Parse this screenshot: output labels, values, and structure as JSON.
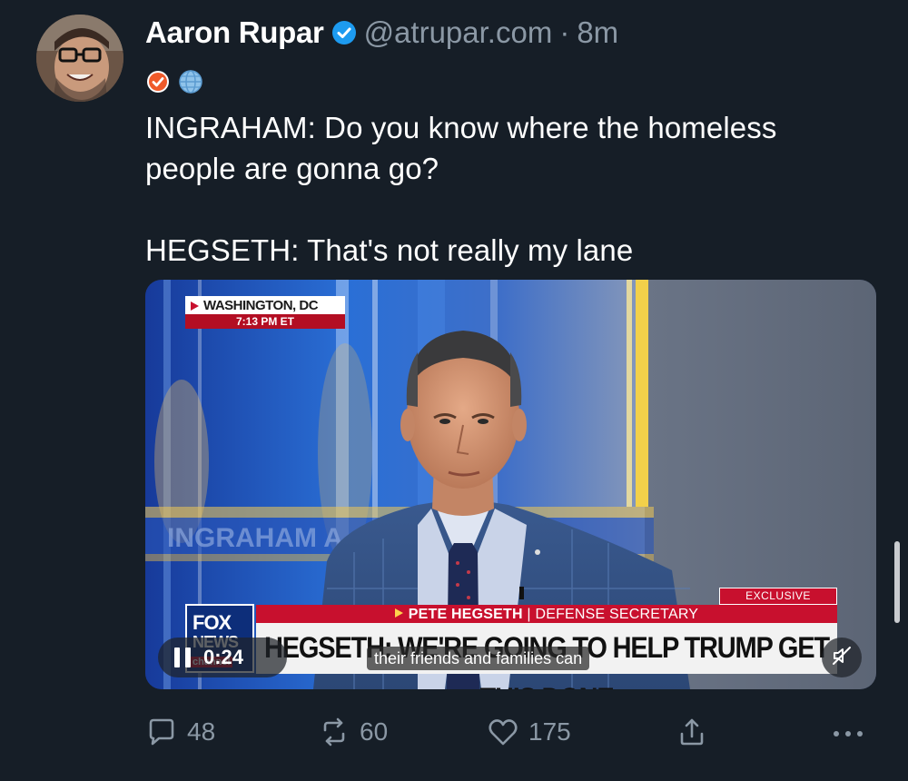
{
  "author": {
    "display_name": "Aaron Rupar",
    "handle": "@atrupar.com",
    "separator": "·",
    "time_ago": "8m"
  },
  "badges": [
    "checkmark-badge-icon",
    "globe-icon"
  ],
  "tweet": {
    "line1": "INGRAHAM: Do you know where the homeless",
    "line2": "people are gonna go?",
    "line3": "HEGSETH: That's not really my lane"
  },
  "video": {
    "dateline_location": "WASHINGTON, DC",
    "dateline_time": "7:13 PM ET",
    "exclusive_tag": "EXCLUSIVE",
    "namebar_name": "PETE HEGSETH",
    "namebar_title": "DEFENSE SECRETARY",
    "headline": "HEGSETH: WE'RE GOING TO HELP TRUMP GET THIS DONE",
    "background_text": "INGRAHAM A",
    "logo_line1": "FOX",
    "logo_line2": "NEWS",
    "logo_line3": "channel",
    "elapsed": "0:24",
    "caption": "their friends and families can",
    "is_playing": true,
    "is_muted": true
  },
  "actions": {
    "replies": "48",
    "reposts": "60",
    "likes": "175"
  },
  "colors": {
    "background": "#161e27",
    "text_secondary": "#8b98a5",
    "verified": "#1d9bf0",
    "fox_red": "#c8102e"
  }
}
